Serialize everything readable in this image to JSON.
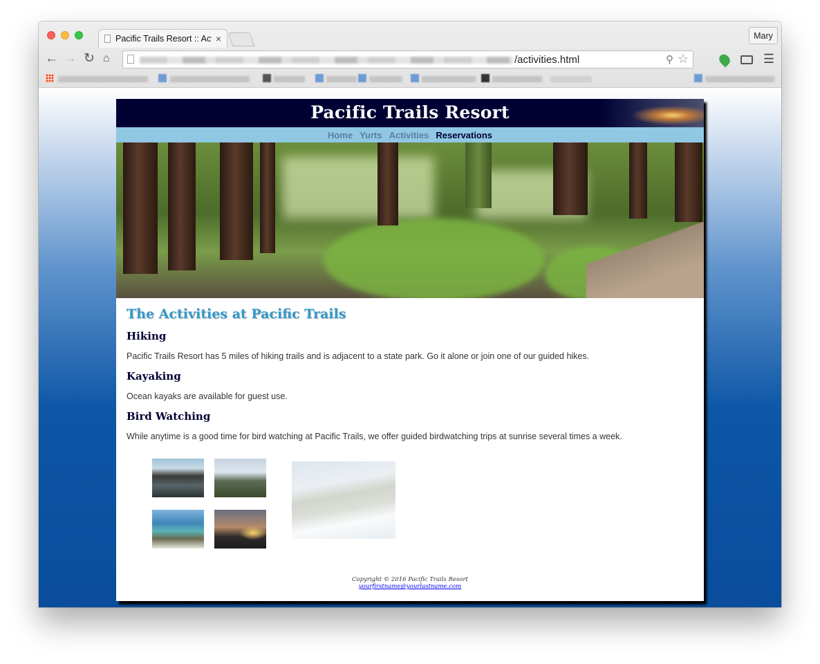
{
  "browser": {
    "tab_title": "Pacific Trails Resort :: Activities",
    "tab_close": "×",
    "profile": "Mary",
    "url_visible": "/activities.html",
    "icons": [
      "back-icon",
      "forward-icon",
      "reload-icon",
      "home-icon",
      "search-icon",
      "star-icon",
      "cast-icon",
      "menu-icon"
    ]
  },
  "site": {
    "title": "Pacific Trails Resort",
    "nav": [
      "Home",
      "Yurts",
      "Activities",
      "Reservations"
    ],
    "heading": "The Activities at Pacific Trails",
    "sections": [
      {
        "heading": "Hiking",
        "text": "Pacific Trails Resort has 5 miles of hiking trails and is adjacent to a state park. Go it alone or join one of our guided hikes."
      },
      {
        "heading": "Kayaking",
        "text": "Ocean kayaks are available for guest use."
      },
      {
        "heading": "Bird Watching",
        "text": "While anytime is a good time for bird watching at Pacific Trails, we offer guided birdwatching trips at sunrise several times a week."
      }
    ],
    "footer": {
      "copyright": "Copyright © 2016 Pacific Trails Resort",
      "email": "yourfirstname@yourlastname.com"
    }
  },
  "colors": {
    "header_bg": "#000033",
    "nav_bg": "#90c7e3",
    "heading": "#3399cc",
    "page_bg_bottom": "#0a4d9c"
  }
}
